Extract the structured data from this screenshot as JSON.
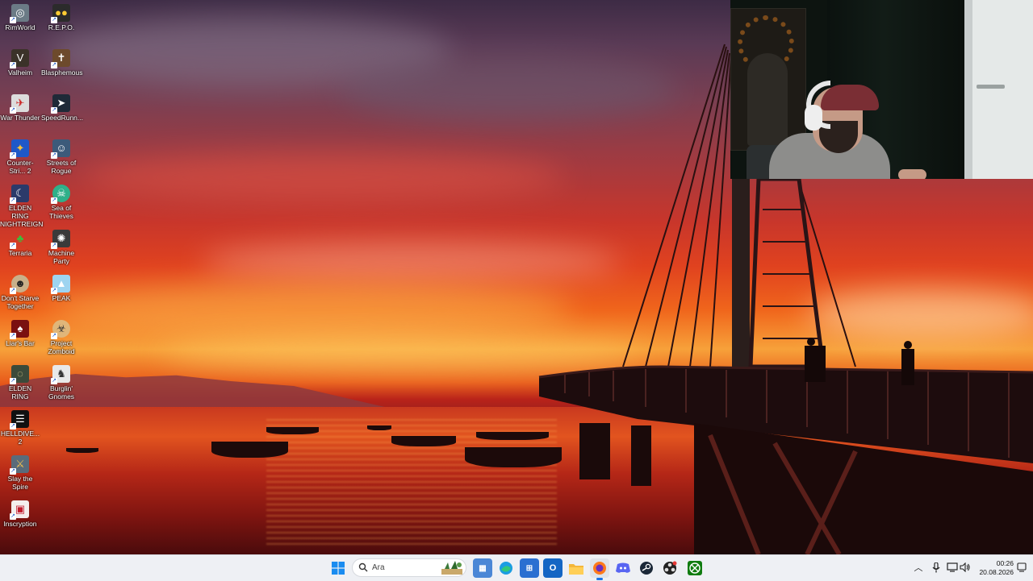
{
  "desktop": {
    "icons": [
      {
        "label": "RimWorld",
        "icon": "rimworld-icon"
      },
      {
        "label": "R.E.P.O.",
        "icon": "repo-icon"
      },
      {
        "label": "Valheim",
        "icon": "valheim-icon"
      },
      {
        "label": "Blasphemous",
        "icon": "blasphemous-icon"
      },
      {
        "label": "War Thunder",
        "icon": "war-thunder-icon"
      },
      {
        "label": "SpeedRunn...",
        "icon": "speedrunners-icon"
      },
      {
        "label": "Counter-Stri... 2",
        "icon": "counter-strike-icon"
      },
      {
        "label": "Streets of Rogue",
        "icon": "streets-of-rogue-icon"
      },
      {
        "label": "ELDEN RING NIGHTREIGN",
        "icon": "elden-ring-nightreign-icon"
      },
      {
        "label": "Sea of Thieves",
        "icon": "sea-of-thieves-icon"
      },
      {
        "label": "Terraria",
        "icon": "terraria-icon"
      },
      {
        "label": "Machine Party",
        "icon": "machine-party-icon"
      },
      {
        "label": "Don't Starve Together",
        "icon": "dont-starve-together-icon"
      },
      {
        "label": "PEAK",
        "icon": "peak-icon"
      },
      {
        "label": "Liar's Bar",
        "icon": "liars-bar-icon"
      },
      {
        "label": "Project Zomboid",
        "icon": "project-zomboid-icon"
      },
      {
        "label": "ELDEN RING",
        "icon": "elden-ring-icon"
      },
      {
        "label": "Burglin' Gnomes",
        "icon": "burglin-gnomes-icon"
      },
      {
        "label": "HELLDIVE... 2",
        "icon": "helldivers-icon"
      },
      {
        "label": "Slay the Spire",
        "icon": "slay-the-spire-icon"
      },
      {
        "label": "Inscryption",
        "icon": "inscryption-icon"
      }
    ]
  },
  "taskbar": {
    "search_placeholder": "Ara",
    "pinned": [
      {
        "name": "start-button",
        "icon": "windows-logo-icon"
      },
      {
        "name": "widgets-button",
        "icon": "widgets-icon"
      },
      {
        "name": "edge-button",
        "icon": "edge-icon"
      },
      {
        "name": "store-button",
        "icon": "store-icon"
      },
      {
        "name": "outlook-button",
        "icon": "outlook-icon"
      },
      {
        "name": "file-explorer-button",
        "icon": "folder-icon"
      },
      {
        "name": "firefox-button",
        "icon": "firefox-icon"
      },
      {
        "name": "discord-button",
        "icon": "discord-icon"
      },
      {
        "name": "steam-button",
        "icon": "steam-icon"
      },
      {
        "name": "obs-button",
        "icon": "obs-icon"
      },
      {
        "name": "xbox-button",
        "icon": "xbox-icon"
      }
    ],
    "tray": {
      "time": "00:26",
      "date": "20.08.2026"
    }
  },
  "colors": {
    "taskbar_bg": "#eef0f4",
    "accent": "#1a73e8"
  }
}
